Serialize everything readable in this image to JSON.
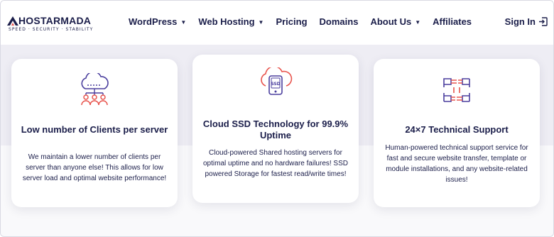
{
  "brand": {
    "name": "HOSTARMADA",
    "tagline": "SPEED · SECURITY · STABILITY"
  },
  "nav": {
    "items": [
      {
        "label": "WordPress",
        "dropdown": true
      },
      {
        "label": "Web Hosting",
        "dropdown": true
      },
      {
        "label": "Pricing",
        "dropdown": false
      },
      {
        "label": "Domains",
        "dropdown": false
      },
      {
        "label": "About Us",
        "dropdown": true
      },
      {
        "label": "Affiliates",
        "dropdown": false
      }
    ],
    "signin_label": "Sign In"
  },
  "cards": [
    {
      "icon": "cloud-clients-icon",
      "title": "Low number of Clients per server",
      "text": "We maintain a lower number of clients per server than anyone else! This allows for low server load and optimal website performance!"
    },
    {
      "icon": "cloud-ssd-icon",
      "title": "Cloud SSD Technology for 99.9% Uptime",
      "text": "Cloud-powered Shared hosting servers for optimal uptime and no hardware failures! SSD powered Storage for fastest read/write times!"
    },
    {
      "icon": "support-hands-icon",
      "title": "24×7 Technical Support",
      "text": "Human-powered technical support service for fast and secure website transfer, template or module installations, and any website-related issues!"
    }
  ],
  "colors": {
    "navy": "#1b1e4a",
    "accent_red": "#e8554e",
    "accent_purple": "#4b3f9e"
  }
}
